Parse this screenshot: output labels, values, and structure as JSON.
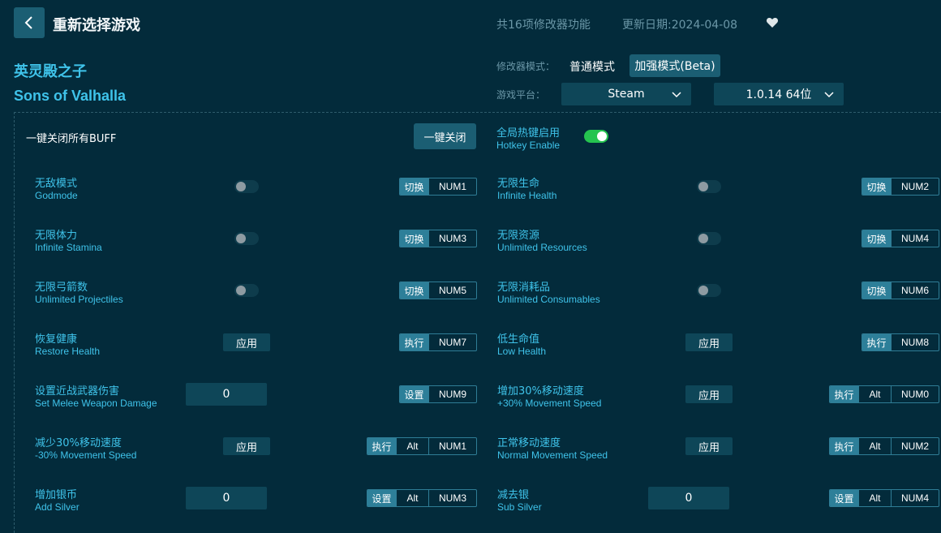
{
  "header": {
    "title": "重新选择游戏",
    "feature_count": "共16项修改器功能",
    "update_date": "更新日期:2024-04-08"
  },
  "game": {
    "name_cn": "英灵殿之子",
    "name_en": "Sons of Valhalla"
  },
  "mode": {
    "label": "修改器模式：",
    "normal": "普通模式",
    "beta": "加强模式(Beta)"
  },
  "platform": {
    "label": "游戏平台：",
    "selected": "Steam",
    "version": "1.0.14 64位"
  },
  "global": {
    "kill_label": "一键关闭所有BUFF",
    "kill_button": "一键关闭",
    "hotkey_cn": "全局热键启用",
    "hotkey_en": "Hotkey Enable"
  },
  "controls": {
    "toggle_action": "切换",
    "exec_action": "执行",
    "set_action": "设置",
    "apply_label": "应用"
  },
  "features": [
    {
      "cn": "无敌模式",
      "en": "Godmode",
      "value": "",
      "keys": [
        "NUM1"
      ]
    },
    {
      "cn": "无限生命",
      "en": "Infinite Health",
      "value": "",
      "keys": [
        "NUM2"
      ]
    },
    {
      "cn": "无限体力",
      "en": "Infinite Stamina",
      "value": "",
      "keys": [
        "NUM3"
      ]
    },
    {
      "cn": "无限资源",
      "en": "Unlimited Resources",
      "value": "",
      "keys": [
        "NUM4"
      ]
    },
    {
      "cn": "无限弓箭数",
      "en": "Unlimited Projectiles",
      "value": "",
      "keys": [
        "NUM5"
      ]
    },
    {
      "cn": "无限消耗品",
      "en": "Unlimited Consumables",
      "value": "",
      "keys": [
        "NUM6"
      ]
    },
    {
      "cn": "恢复健康",
      "en": "Restore Health",
      "value": "",
      "keys": [
        "NUM7"
      ]
    },
    {
      "cn": "低生命值",
      "en": "Low Health",
      "value": "",
      "keys": [
        "NUM8"
      ]
    },
    {
      "cn": "设置近战武器伤害",
      "en": "Set Melee Weapon Damage",
      "value": "0",
      "keys": [
        "NUM9"
      ]
    },
    {
      "cn": "增加30%移动速度",
      "en": "+30% Movement Speed",
      "value": "",
      "keys": [
        "Alt",
        "NUM0"
      ]
    },
    {
      "cn": "减少30%移动速度",
      "en": "-30% Movement Speed",
      "value": "",
      "keys": [
        "Alt",
        "NUM1"
      ]
    },
    {
      "cn": "正常移动速度",
      "en": "Normal Movement Speed",
      "value": "",
      "keys": [
        "Alt",
        "NUM2"
      ]
    },
    {
      "cn": "增加银币",
      "en": "Add Silver",
      "value": "0",
      "keys": [
        "Alt",
        "NUM3"
      ]
    },
    {
      "cn": "减去银",
      "en": "Sub Silver",
      "value": "0",
      "keys": [
        "Alt",
        "NUM4"
      ]
    }
  ],
  "colors": {
    "background": "#032b3b",
    "accent": "#3fc3ea",
    "button": "#1b5e73",
    "toggle_on": "#25c44f"
  }
}
